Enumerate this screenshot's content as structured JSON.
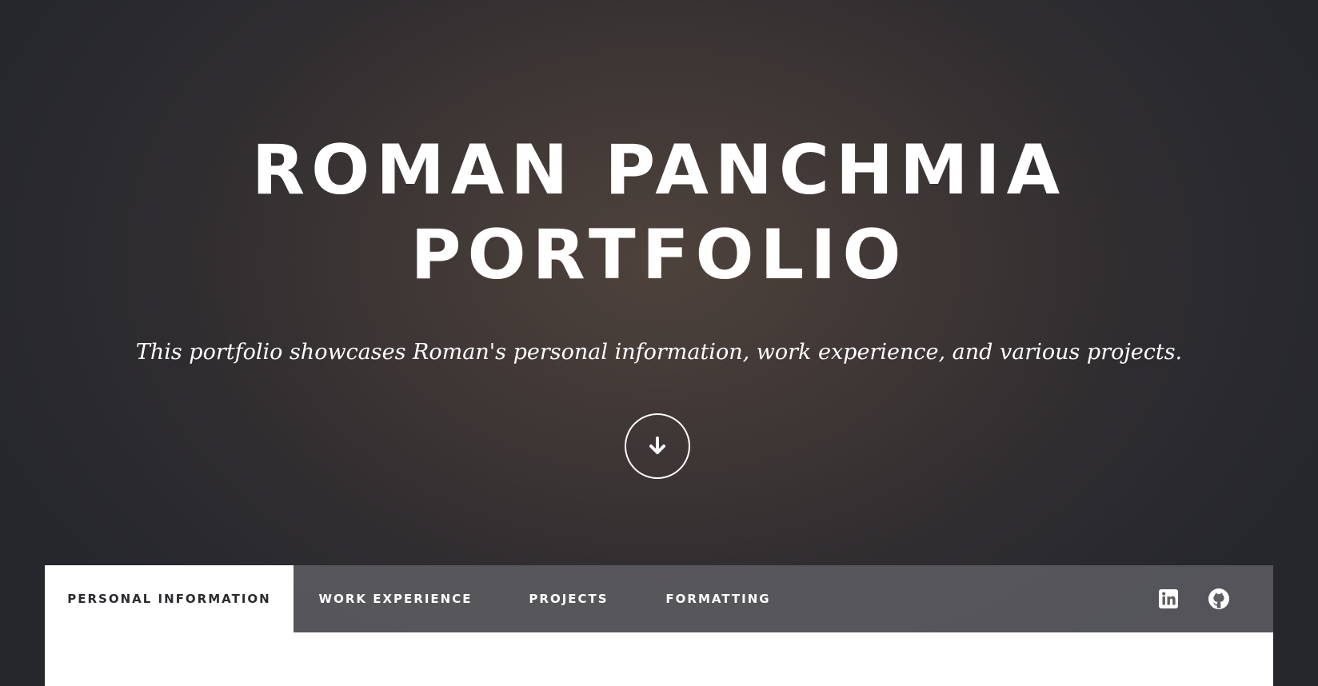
{
  "hero": {
    "title_line1": "ROMAN PANCHMIA",
    "title_line2": "PORTFOLIO",
    "subtitle": "This portfolio showcases Roman's personal information, work experience, and various projects.",
    "scroll_icon": "arrow-down-icon"
  },
  "nav": {
    "tabs": [
      {
        "label": "PERSONAL INFORMATION",
        "active": true
      },
      {
        "label": "WORK EXPERIENCE",
        "active": false
      },
      {
        "label": "PROJECTS",
        "active": false
      },
      {
        "label": "FORMATTING",
        "active": false
      }
    ],
    "social": [
      {
        "icon": "linkedin-icon"
      },
      {
        "icon": "github-icon"
      }
    ]
  },
  "colors": {
    "text": "#ffffff",
    "nav_bar": "#5e5e64",
    "active_tab_bg": "#ffffff",
    "active_tab_text": "#2a2a30"
  }
}
